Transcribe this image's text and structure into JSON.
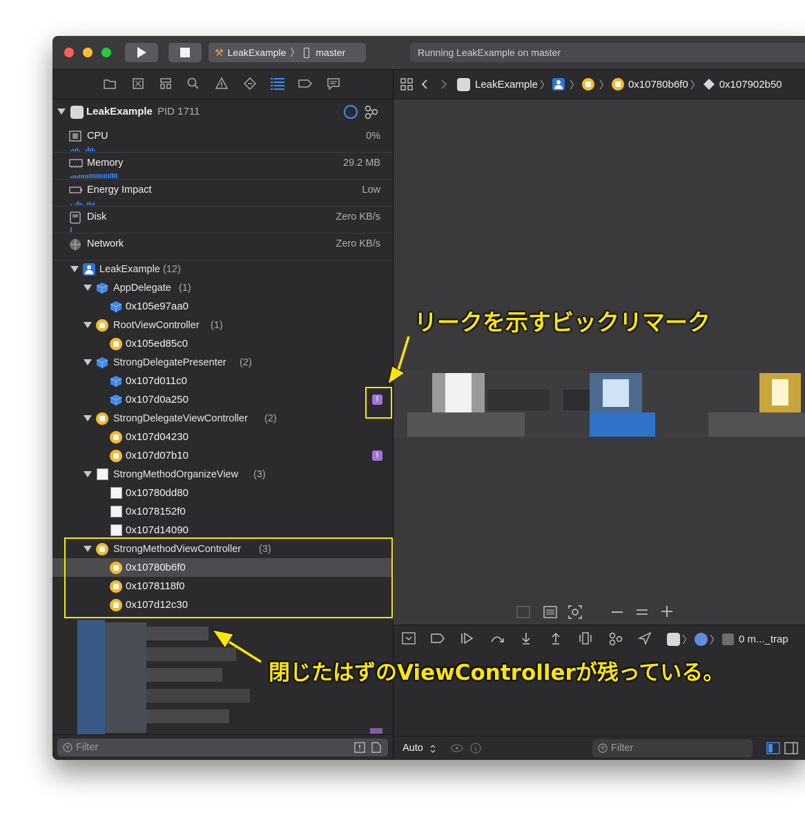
{
  "toolbar": {
    "scheme_name": "LeakExample",
    "scheme_sep": "〉",
    "device_name": "master",
    "activity_text": "Running LeakExample on master"
  },
  "navigator": {
    "process_name": "LeakExample",
    "process_pid": "PID 1711",
    "gauges": [
      {
        "label": "CPU",
        "value": "0%"
      },
      {
        "label": "Memory",
        "value": "29.2 MB"
      },
      {
        "label": "Energy Impact",
        "value": "Low"
      },
      {
        "label": "Disk",
        "value": "Zero KB/s"
      },
      {
        "label": "Network",
        "value": "Zero KB/s"
      }
    ],
    "tree": {
      "root": {
        "label": "LeakExample",
        "count": "(12)"
      },
      "groups": [
        {
          "label": "AppDelegate",
          "count": "(1)",
          "items": [
            "0x105e97aa0"
          ]
        },
        {
          "label": "RootViewController",
          "count": "(1)",
          "items": [
            "0x105ed85c0"
          ]
        },
        {
          "label": "StrongDelegatePresenter",
          "count": "(2)",
          "items": [
            "0x107d011c0",
            "0x107d0a250"
          ]
        },
        {
          "label": "StrongDelegateViewController",
          "count": "(2)",
          "items": [
            "0x107d04230",
            "0x107d07b10"
          ]
        },
        {
          "label": "StrongMethodOrganizeView",
          "count": "(3)",
          "items": [
            "0x10780dd80",
            "0x1078152f0",
            "0x107d14090"
          ]
        },
        {
          "label": "StrongMethodViewController",
          "count": "(3)",
          "items": [
            "0x10780b6f0",
            "0x1078118f0",
            "0x107d12c30"
          ]
        }
      ]
    },
    "warning_mark": "!",
    "filter_placeholder": "Filter"
  },
  "jumpbar": {
    "items": [
      "LeakExample",
      "0x10780b6f0",
      "0x107902b50"
    ],
    "sep": "〉"
  },
  "debugbar": {
    "frame_label": "0 m..._trap"
  },
  "editor_footer": {
    "mode": "Auto",
    "filter_placeholder": "Filter"
  },
  "annotations": {
    "top": "リークを示すビックリマーク",
    "bottom": "閉じたはずのViewControllerが残っている。"
  },
  "colors": {
    "highlight": "#ffe600",
    "accent": "#3d8ef7",
    "warning_badge": "#a274d6"
  }
}
